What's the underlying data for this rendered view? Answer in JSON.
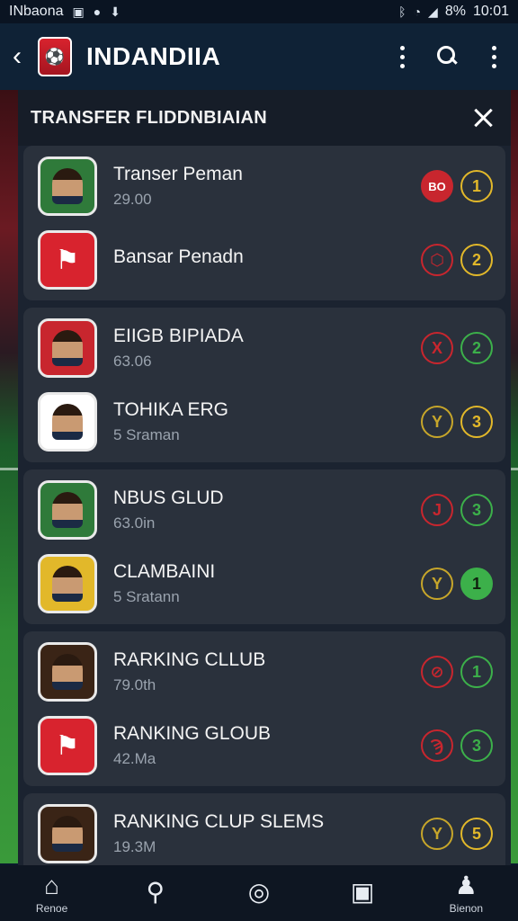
{
  "status_bar": {
    "carrier": "INbaona",
    "battery": "8%",
    "time": "10:01",
    "icons": [
      "notification-icon",
      "chat-icon",
      "download-icon",
      "bluetooth-icon",
      "wifi-icon",
      "signal-icon"
    ]
  },
  "app_bar": {
    "title": "INDANDIIA",
    "icons": [
      "back-icon",
      "club-logo",
      "more-icon",
      "search-icon",
      "overflow-icon"
    ]
  },
  "panel": {
    "title": "TRANSFER FLIDDNBIAIAN",
    "close_icon": "close-icon"
  },
  "groups": [
    {
      "items": [
        {
          "name": "Transer Peman",
          "sub": "29.00",
          "badge_bg": "#2f7a3a",
          "badge_kind": "player",
          "icon_color": "#c8262e",
          "icon_glyph": "BO",
          "rank": "1",
          "rank_style": "yellow"
        },
        {
          "name": "Bansar Penadn",
          "sub": "",
          "badge_bg": "#d8232e",
          "badge_kind": "crest",
          "icon_color": "#c8262e",
          "icon_glyph": "⬡",
          "rank": "2",
          "rank_style": "yellow"
        }
      ]
    },
    {
      "items": [
        {
          "name": "EIIGB BIPIADA",
          "sub": "63.06",
          "badge_bg": "#c8262e",
          "badge_kind": "player",
          "icon_color": "#c8262e",
          "icon_glyph": "X",
          "rank": "2",
          "rank_style": "green"
        },
        {
          "name": "TOHIKA ERG",
          "sub": "5 Sraman",
          "badge_bg": "#ffffff",
          "badge_kind": "player",
          "icon_color": "#c7a62a",
          "icon_glyph": "Y",
          "rank": "3",
          "rank_style": "yellow"
        }
      ]
    },
    {
      "items": [
        {
          "name": "NBUS GLUD",
          "sub": "63.0in",
          "badge_bg": "#2f7a3a",
          "badge_kind": "player",
          "icon_color": "#c8262e",
          "icon_glyph": "J",
          "rank": "3",
          "rank_style": "green"
        },
        {
          "name": "CLAMBAINI",
          "sub": "5 Sratann",
          "badge_bg": "#e2b82a",
          "badge_kind": "player",
          "icon_color": "#c7a62a",
          "icon_glyph": "Y",
          "rank": "1",
          "rank_style": "green-fill"
        }
      ]
    },
    {
      "items": [
        {
          "name": "RARKING CLLUB",
          "sub": "79.0th",
          "badge_bg": "#3a2416",
          "badge_kind": "player",
          "icon_color": "#c8262e",
          "icon_glyph": "⊘",
          "rank": "1",
          "rank_style": "green"
        },
        {
          "name": "RANKING GLOUB",
          "sub": "42.Ma",
          "badge_bg": "#d8232e",
          "badge_kind": "crest",
          "icon_color": "#c8262e",
          "icon_glyph": "Ϡ",
          "rank": "3",
          "rank_style": "green"
        }
      ]
    },
    {
      "items": [
        {
          "name": "RANKING CLUP SLEMS",
          "sub": "19.3M",
          "badge_bg": "#3a2416",
          "badge_kind": "player",
          "icon_color": "#c7a62a",
          "icon_glyph": "Y",
          "rank": "5",
          "rank_style": "yellow"
        }
      ]
    }
  ],
  "bottom_nav": [
    {
      "icon": "home-icon",
      "glyph": "⌂",
      "label": "Renoe"
    },
    {
      "icon": "search-icon",
      "glyph": "⚲",
      "label": ""
    },
    {
      "icon": "ball-icon",
      "glyph": "◎",
      "label": ""
    },
    {
      "icon": "card-icon",
      "glyph": "▣",
      "label": ""
    },
    {
      "icon": "profile-icon",
      "glyph": "♟",
      "label": "Bienon"
    }
  ]
}
